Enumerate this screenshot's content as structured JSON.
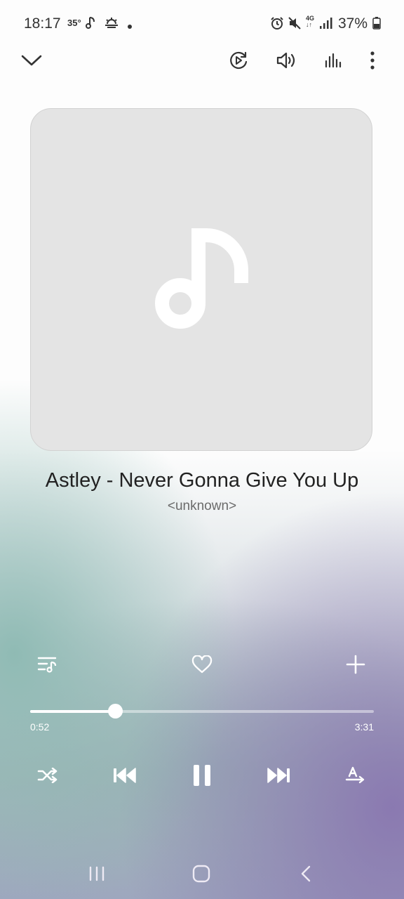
{
  "status_bar": {
    "time": "18:17",
    "temperature": "35°",
    "battery": "37%",
    "network": "4G",
    "icons": [
      "music-note-icon",
      "weather-icon",
      "dot-icon",
      "alarm-icon",
      "mute-icon",
      "signal-icon",
      "battery-icon"
    ]
  },
  "toolbar": {
    "collapse_icon": "chevron-down-icon",
    "playback_icon": "playback-icon",
    "volume_icon": "volume-icon",
    "equalizer_icon": "equalizer-icon",
    "more_icon": "more-vertical-icon"
  },
  "album_art": {
    "placeholder_icon": "music-note-icon"
  },
  "track": {
    "title": "Astley - Never Gonna Give You Up",
    "artist": "<unknown>"
  },
  "actions": {
    "queue_icon": "queue-icon",
    "favorite_icon": "heart-icon",
    "add_icon": "plus-icon"
  },
  "progress": {
    "elapsed": "0:52",
    "total": "3:31",
    "fraction": 0.246
  },
  "controls": {
    "shuffle_icon": "shuffle-icon",
    "previous_icon": "skip-previous-icon",
    "play_pause_icon": "pause-icon",
    "next_icon": "skip-next-icon",
    "repeat_icon": "repeat-icon"
  },
  "nav_bar": {
    "recents_icon": "recents-icon",
    "home_icon": "home-icon",
    "back_icon": "back-icon"
  },
  "colors": {
    "accent": "#ffffff",
    "bg_teal": "#8cb9b2",
    "bg_purple": "#8976b0",
    "album_bg": "#e4e4e4"
  }
}
